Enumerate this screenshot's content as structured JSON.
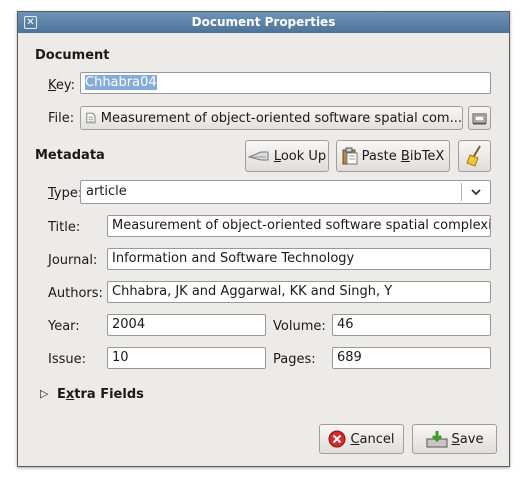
{
  "window": {
    "title": "Document Properties"
  },
  "document_section": {
    "heading": "Document",
    "key_label_u": "K",
    "key_label_rest": "ey:",
    "key_value": "Chhabra04",
    "file_label": "File:",
    "file_value": "Measurement of object-oriented software spatial com..."
  },
  "metadata": {
    "heading": "Metadata",
    "lookup_u": "L",
    "lookup_rest": "ook Up",
    "paste_pre": "Paste ",
    "paste_u": "B",
    "paste_rest": "ibTeX",
    "type_label_u": "T",
    "type_label_rest": "ype:",
    "type_value": "article",
    "title_label": "Title:",
    "title_value": "Measurement of object-oriented software spatial complexit",
    "journal_label": "Journal:",
    "journal_value": "Information and Software Technology",
    "authors_label": "Authors:",
    "authors_value": "Chhabra, JK and Aggarwal, KK and Singh, Y",
    "year_label": "Year:",
    "year_value": "2004",
    "volume_label": "Volume:",
    "volume_value": "46",
    "issue_label": "Issue:",
    "issue_value": "10",
    "pages_label": "Pages:",
    "pages_value": "689"
  },
  "extra": {
    "label_pre": "E",
    "label_u": "x",
    "label_rest": "tra Fields"
  },
  "footer": {
    "cancel_u": "C",
    "cancel_rest": "ancel",
    "save_u": "S",
    "save_rest": "ave"
  },
  "icons": {
    "close": "close-icon",
    "file": "document-icon",
    "browse": "folder-open-icon",
    "lookup": "magnifier-icon",
    "paste": "clipboard-icon",
    "clear": "broom-icon",
    "combo": "chevron-down-icon",
    "expander": "triangle-right-icon",
    "cancel": "cancel-icon",
    "save": "save-icon"
  },
  "colors": {
    "titlebar": "#5a7fa4",
    "selection": "#86abd9",
    "cancel_red": "#d62a2a"
  }
}
